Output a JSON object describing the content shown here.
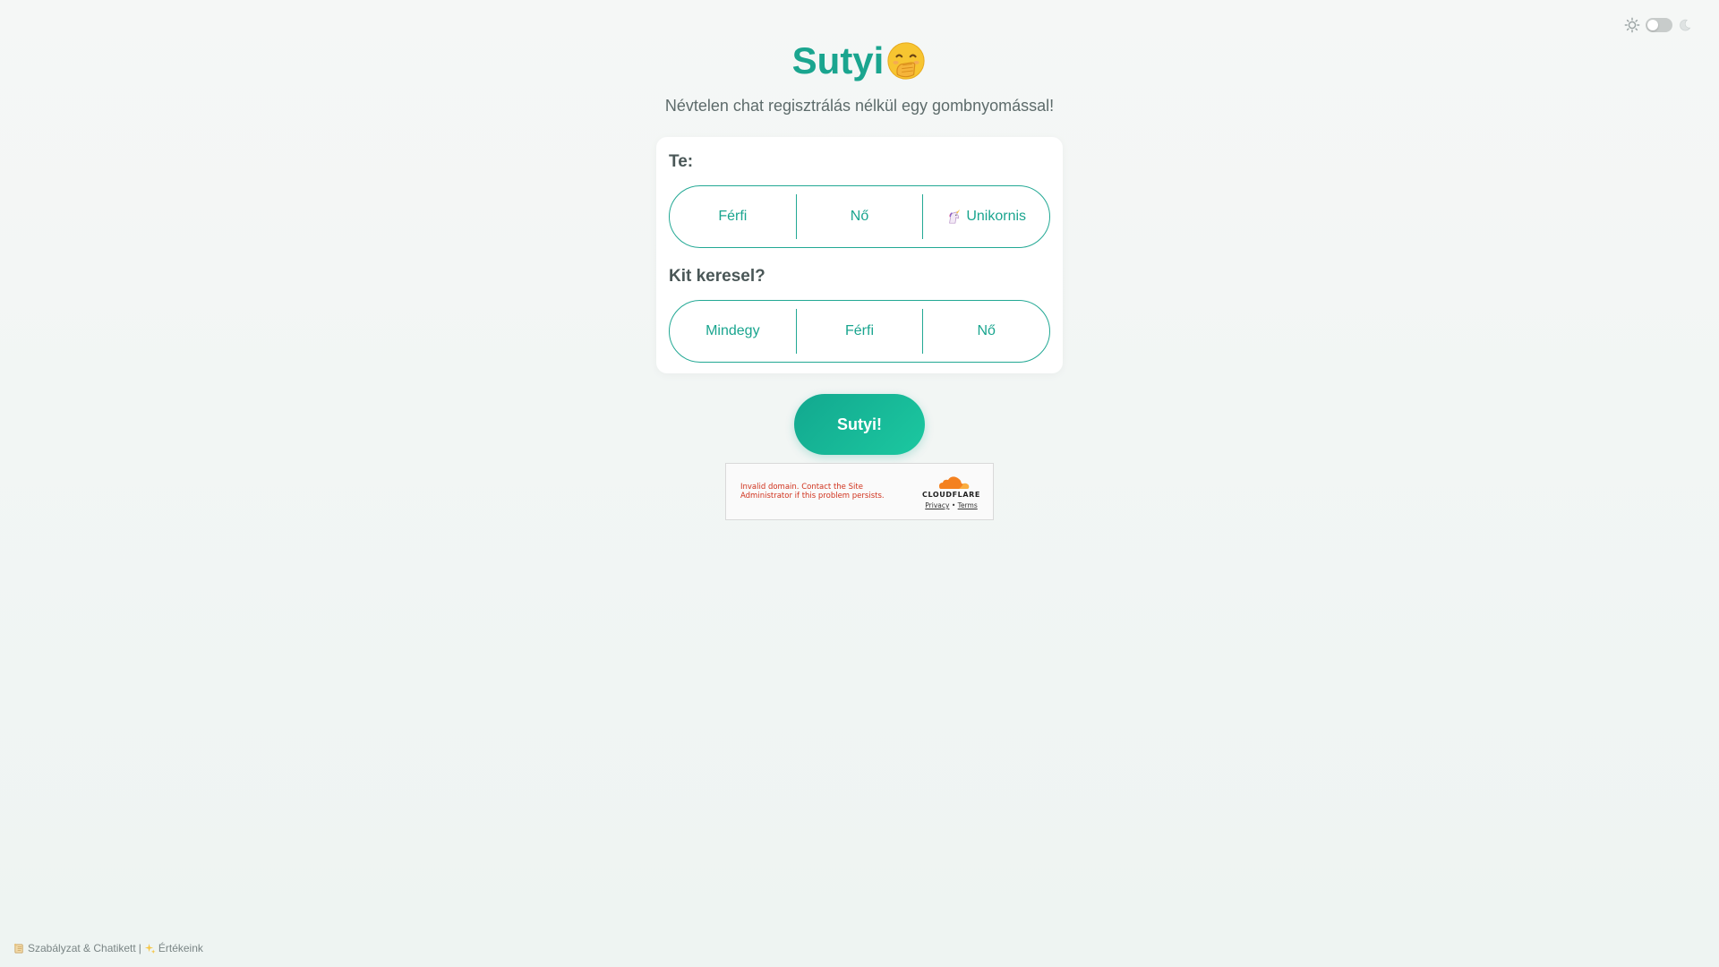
{
  "header": {
    "title": "Sutyi",
    "subtitle": "Névtelen chat regisztrálás nélkül egy gombnyomással!",
    "title_icon": "hand-over-mouth-emoji"
  },
  "card": {
    "self_label": "Te:",
    "self_options": [
      "Férfi",
      "Nő",
      "Unikornis"
    ],
    "self_option_icons": [
      "",
      "",
      "unicorn-icon"
    ],
    "seek_label": "Kit keresel?",
    "seek_options": [
      "Mindegy",
      "Férfi",
      "Nő"
    ]
  },
  "go_button": {
    "label": "Sutyi!"
  },
  "captcha": {
    "error": "Invalid domain. Contact the Site Administrator if this problem persists.",
    "brand": "CLOUDFLARE",
    "privacy": "Privacy",
    "separator": "•",
    "terms": "Terms"
  },
  "footer": {
    "rules_link": "Szabályzat & Chatikett",
    "separator": "|",
    "values_link": "Értékeink"
  },
  "theme": {
    "mode": "light"
  },
  "colors": {
    "accent": "#1aa58f",
    "button_gradient_start": "#12a88f",
    "button_gradient_end": "#1cc8a0",
    "error": "#d0321d"
  }
}
